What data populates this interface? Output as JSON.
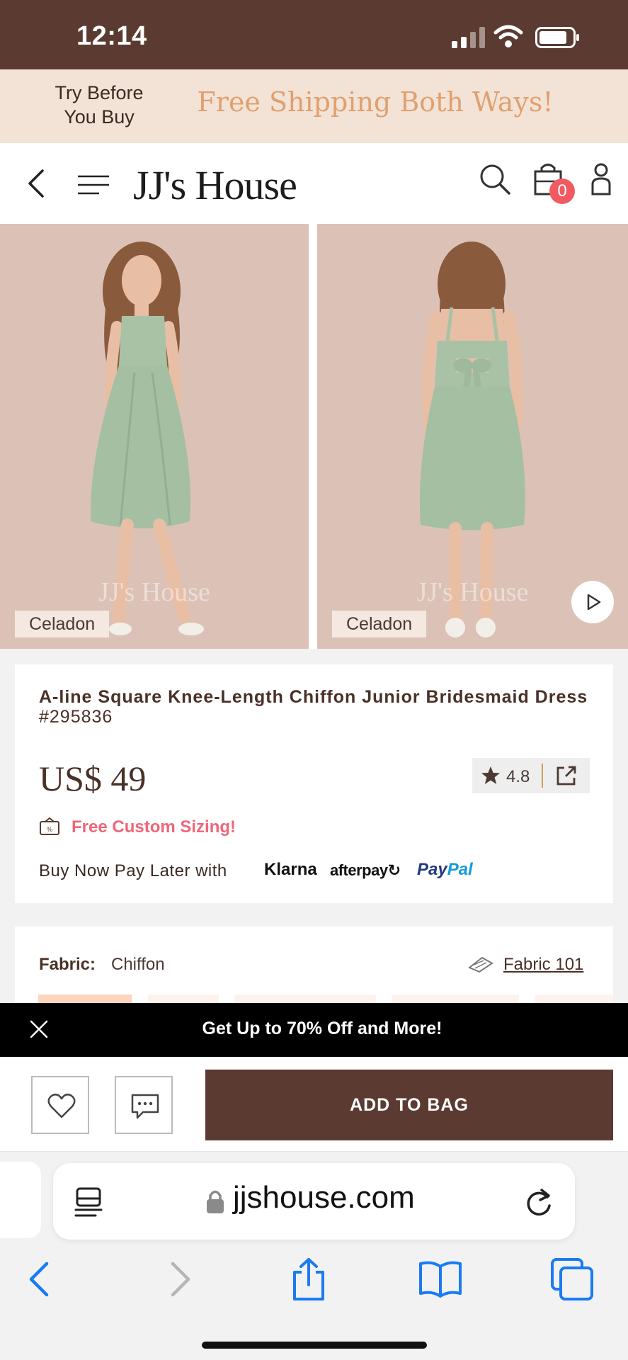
{
  "status_bar": {
    "time": "12:14"
  },
  "promo_banner": {
    "try_before": "Try Before You Buy",
    "shipping": "Free Shipping Both Ways!"
  },
  "header": {
    "logo": "JJ's House",
    "cart_count": "0"
  },
  "gallery": {
    "images": [
      {
        "color_label": "Celadon",
        "watermark": "JJ's House"
      },
      {
        "color_label": "Celadon",
        "watermark": "JJ's House"
      }
    ]
  },
  "product": {
    "name": "A-line Square Knee-Length Chiffon Junior Bridesmaid Dress",
    "sku": "#295836",
    "price": "US$ 49",
    "rating": "4.8",
    "custom_sizing": "Free Custom Sizing!",
    "bnpl_text": "Buy Now Pay Later with",
    "payment_klarna": "Klarna",
    "payment_afterpay": "afterpay",
    "payment_paypal_pay": "Pay",
    "payment_paypal_pal": "Pal"
  },
  "fabric": {
    "label": "Fabric:",
    "value": "Chiffon",
    "link": "Fabric 101"
  },
  "deal_bar": {
    "text": "Get Up to 70% Off and More!"
  },
  "actions": {
    "add_to_bag": "ADD TO BAG"
  },
  "browser": {
    "url": "jjshouse.com"
  },
  "colors": {
    "brand_brown": "#5b3b31",
    "promo_bg": "#f3e3d6",
    "sizing_pink": "#f0667a",
    "dress_sage": "#a9c2a6",
    "safari_blue": "#1a7bf2"
  },
  "icons": [
    "back-icon",
    "menu-icon",
    "search-icon",
    "bag-icon",
    "account-icon",
    "play-icon",
    "star-icon",
    "share-icon",
    "tag-icon",
    "fabric-icon",
    "close-icon",
    "heart-icon",
    "chat-icon",
    "reader-icon",
    "lock-icon",
    "reload-icon",
    "nav-back-icon",
    "nav-forward-icon",
    "share-sheet-icon",
    "bookmarks-icon",
    "tabs-icon"
  ]
}
